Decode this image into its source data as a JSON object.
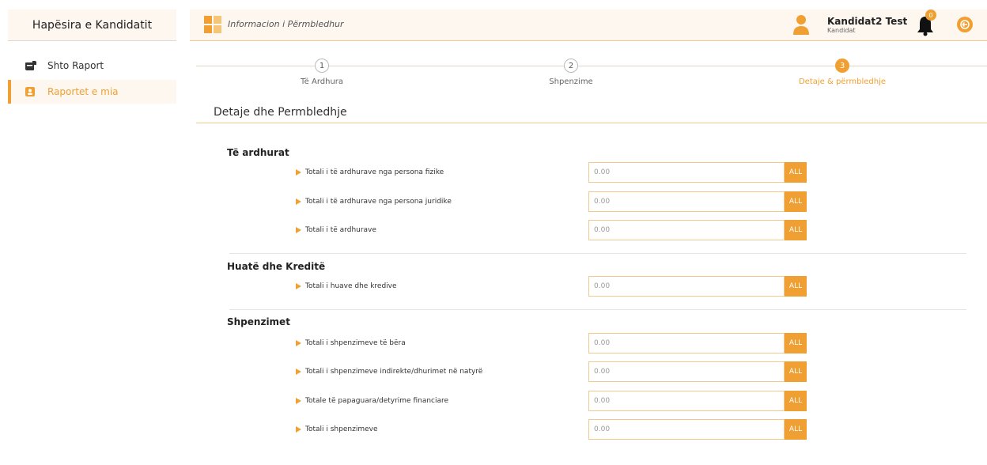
{
  "sidebar": {
    "title": "Hapësira e Kandidatit",
    "items": [
      {
        "label": "Shto Raport",
        "icon": "report-add-icon"
      },
      {
        "label": "Raportet e mia",
        "icon": "contact-book-icon"
      }
    ]
  },
  "topbar": {
    "title": "Informacion i Përmbledhur",
    "user_name": "Kandidat2 Test",
    "user_role": "Kandidat",
    "notifications": "0",
    "accent": "#f0a032"
  },
  "stepper": [
    {
      "num": "1",
      "label": "Të Ardhura"
    },
    {
      "num": "2",
      "label": "Shpenzime"
    },
    {
      "num": "3",
      "label": "Detaje & përmbledhje"
    }
  ],
  "section_title": "Detaje dhe Permbledhje",
  "groups": [
    {
      "title": "Të ardhurat",
      "rows": [
        {
          "label": "Totali i të ardhurave nga persona fizike",
          "value": "0.00",
          "unit": "ALL"
        },
        {
          "label": "Totali i të ardhurave nga persona juridike",
          "value": "0.00",
          "unit": "ALL"
        },
        {
          "label": "Totali i të ardhurave",
          "value": "0.00",
          "unit": "ALL"
        }
      ]
    },
    {
      "title": "Huatë dhe Kreditë",
      "rows": [
        {
          "label": "Totali i huave dhe kredive",
          "value": "0.00",
          "unit": "ALL"
        }
      ]
    },
    {
      "title": "Shpenzimet",
      "rows": [
        {
          "label": "Totali i shpenzimeve të bëra",
          "value": "0.00",
          "unit": "ALL"
        },
        {
          "label": "Totali i shpenzimeve indirekte/dhurimet në natyrë",
          "value": "0.00",
          "unit": "ALL"
        },
        {
          "label": "Totale të papaguara/detyrime financiare",
          "value": "0.00",
          "unit": "ALL"
        },
        {
          "label": "Totali i shpenzimeve",
          "value": "0.00",
          "unit": "ALL"
        }
      ]
    }
  ]
}
